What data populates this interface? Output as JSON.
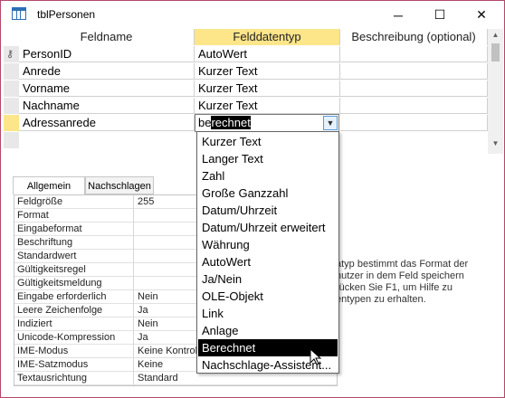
{
  "window": {
    "title": "tblPersonen",
    "minimize": "─",
    "maximize": "☐",
    "close": "✕"
  },
  "grid": {
    "headers": {
      "field_name": "Feldname",
      "data_type": "Felddatentyp",
      "description": "Beschreibung (optional)"
    },
    "rows": [
      {
        "name": "PersonID",
        "type": "AutoWert",
        "key": true
      },
      {
        "name": "Anrede",
        "type": "Kurzer Text",
        "key": false
      },
      {
        "name": "Vorname",
        "type": "Kurzer Text",
        "key": false
      },
      {
        "name": "Nachname",
        "type": "Kurzer Text",
        "key": false
      },
      {
        "name": "Adressanrede",
        "type": "berechnet",
        "key": false
      }
    ],
    "current_input": {
      "prefix": "be",
      "highlighted": "rechnet"
    }
  },
  "dropdown": {
    "options": [
      "Kurzer Text",
      "Langer Text",
      "Zahl",
      "Große Ganzzahl",
      "Datum/Uhrzeit",
      "Datum/Uhrzeit erweitert",
      "Währung",
      "AutoWert",
      "Ja/Nein",
      "OLE-Objekt",
      "Link",
      "Anlage",
      "Berechnet",
      "Nachschlage-Assistent..."
    ],
    "selected_index": 12
  },
  "properties": {
    "tabs": {
      "general": "Allgemein",
      "lookup": "Nachschlagen"
    },
    "rows": [
      {
        "name": "Feldgröße",
        "value": "255"
      },
      {
        "name": "Format",
        "value": ""
      },
      {
        "name": "Eingabeformat",
        "value": ""
      },
      {
        "name": "Beschriftung",
        "value": ""
      },
      {
        "name": "Standardwert",
        "value": ""
      },
      {
        "name": "Gültigkeitsregel",
        "value": ""
      },
      {
        "name": "Gültigkeitsmeldung",
        "value": ""
      },
      {
        "name": "Eingabe erforderlich",
        "value": "Nein"
      },
      {
        "name": "Leere Zeichenfolge",
        "value": "Ja"
      },
      {
        "name": "Indiziert",
        "value": "Nein"
      },
      {
        "name": "Unicode-Kompression",
        "value": "Ja"
      },
      {
        "name": "IME-Modus",
        "value": "Keine Kontrolle"
      },
      {
        "name": "IME-Satzmodus",
        "value": "Keine"
      },
      {
        "name": "Textausrichtung",
        "value": "Standard"
      }
    ],
    "help_lines": [
      "atyp bestimmt das Format der",
      "nutzer in dem Feld speichern",
      "rücken Sie F1, um Hilfe zu",
      "entypen zu erhalten."
    ]
  },
  "colors": {
    "accent_header": "#fde58a",
    "window_border": "#b4486b"
  }
}
